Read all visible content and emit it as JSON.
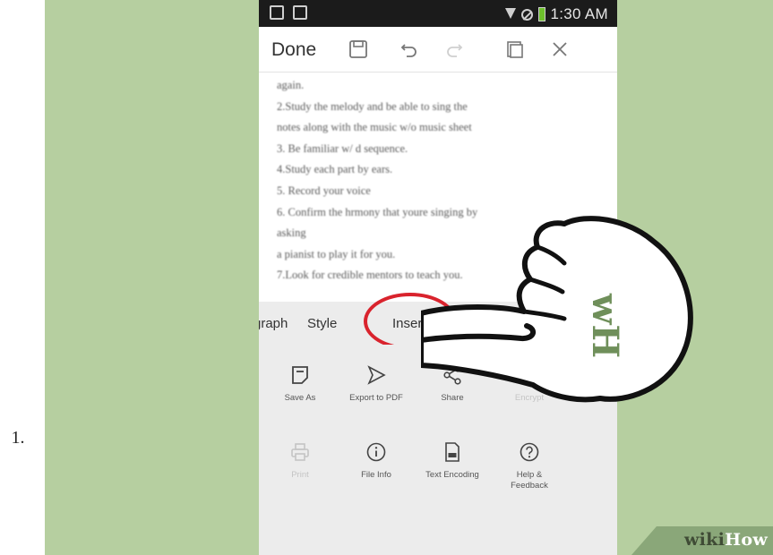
{
  "list_marker": "1.",
  "status_bar": {
    "time": "1:30 AM"
  },
  "toolbar": {
    "done_label": "Done"
  },
  "document": {
    "lines": [
      "again.",
      "2.Study the melody and be able to sing the",
      "notes along with the music w/o music sheet",
      "3. Be familiar w/ d sequence.",
      "4.Study each part by ears.",
      "5. Record your voice",
      "6. Confirm the hrmony that youre singing by",
      "asking",
      "a pianist to play it for you.",
      "7.Look for credible mentors to teach you."
    ]
  },
  "tabs": {
    "paragraph": "graph",
    "style": "Style",
    "insert": "Insert"
  },
  "grid": {
    "save_as": "Save As",
    "export_pdf": "Export to PDF",
    "share": "Share",
    "encrypt": "Encrypt",
    "print": "Print",
    "file_info": "File Info",
    "text_encoding": "Text Encoding",
    "help_line1": "Help &",
    "help_line2": "Feedback"
  },
  "hand_logo": "wH",
  "watermark": {
    "wiki": "wiki",
    "how": "How"
  },
  "colors": {
    "background": "#b6cfa0",
    "highlight": "#d9232d",
    "logo_green": "#6f8f5a"
  }
}
